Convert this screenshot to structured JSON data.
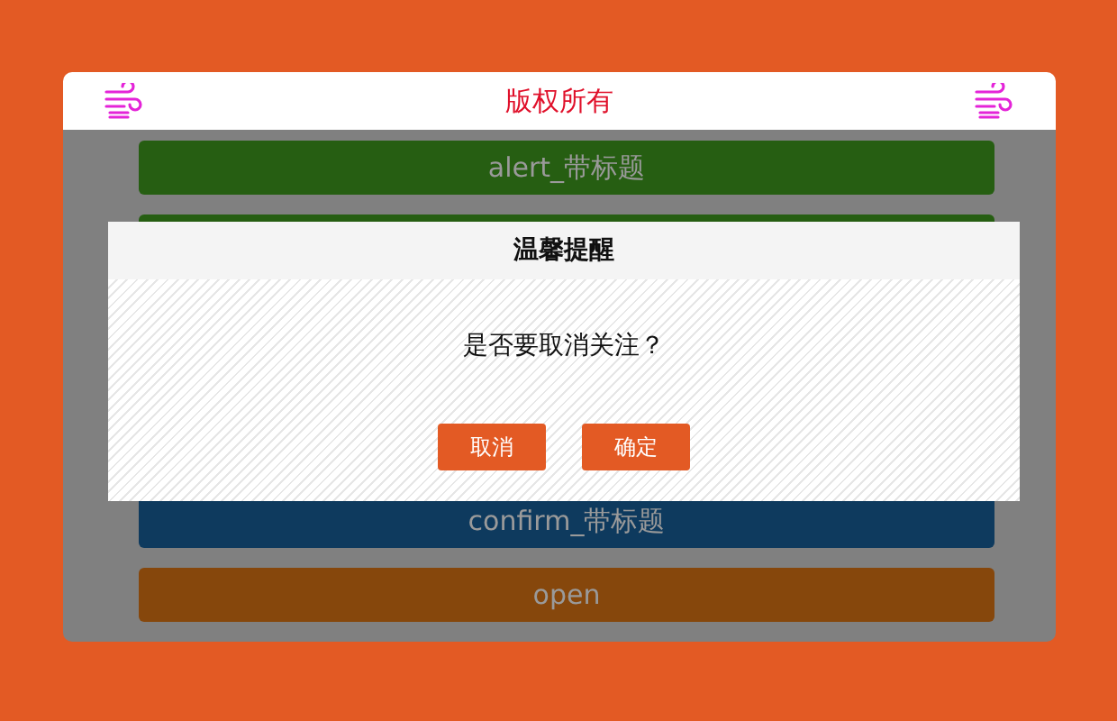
{
  "header": {
    "title": "版权所有"
  },
  "buttons": [
    {
      "label": "alert_带标题",
      "color": "#265e12"
    },
    {
      "color": "#265e12"
    },
    {
      "label": "confirm_带标题",
      "color": "#0e3a5e"
    },
    {
      "label": "open",
      "color": "#86470c"
    }
  ],
  "dialog": {
    "title": "温馨提醒",
    "message": "是否要取消关注？",
    "buttons": [
      "取消",
      "确定"
    ]
  }
}
